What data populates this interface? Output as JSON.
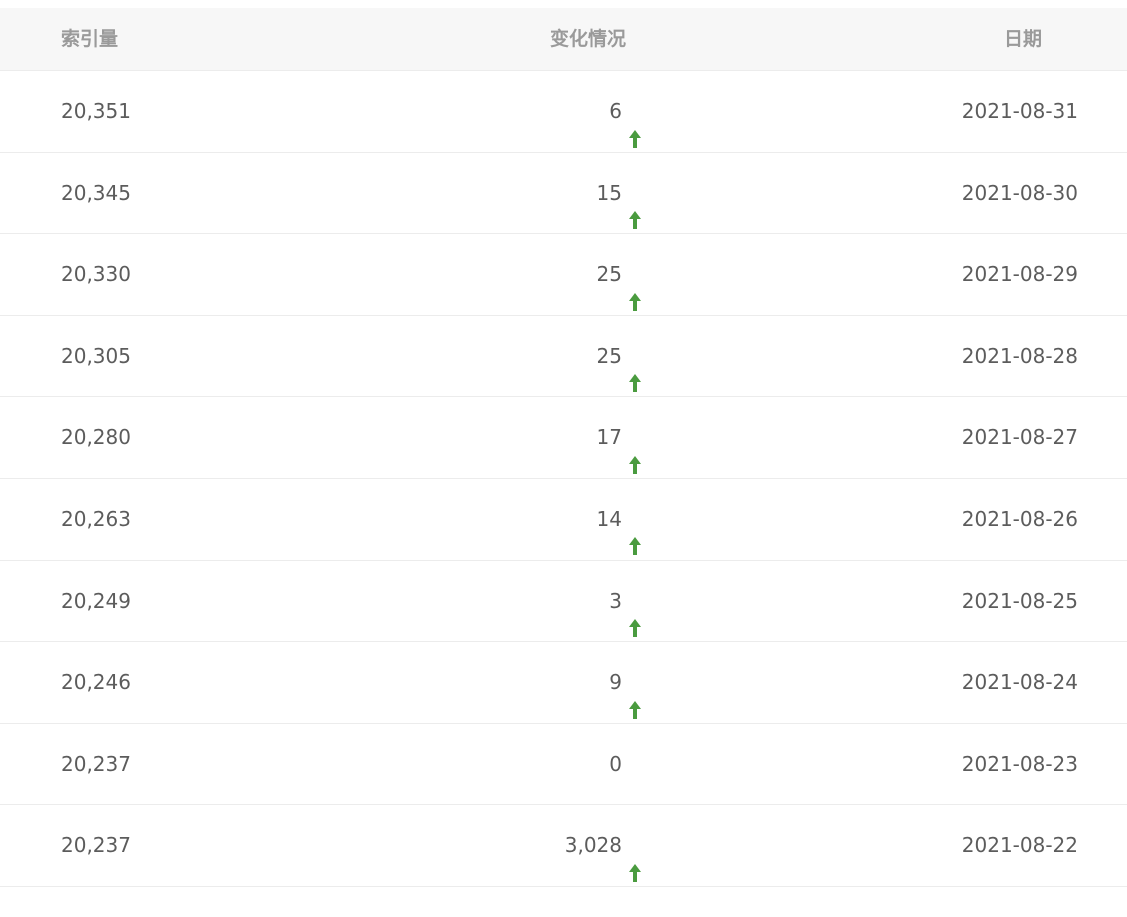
{
  "table": {
    "headers": {
      "index": "索引量",
      "change": "变化情况",
      "date": "日期"
    },
    "colors": {
      "up_arrow": "#4a9b3f",
      "header_bg": "#f7f7f7",
      "header_text": "#9a9a9a",
      "cell_text": "#5c5c5c"
    },
    "rows": [
      {
        "index": "20,351",
        "change": "6",
        "trend": "up",
        "date": "2021-08-31"
      },
      {
        "index": "20,345",
        "change": "15",
        "trend": "up",
        "date": "2021-08-30"
      },
      {
        "index": "20,330",
        "change": "25",
        "trend": "up",
        "date": "2021-08-29"
      },
      {
        "index": "20,305",
        "change": "25",
        "trend": "up",
        "date": "2021-08-28"
      },
      {
        "index": "20,280",
        "change": "17",
        "trend": "up",
        "date": "2021-08-27"
      },
      {
        "index": "20,263",
        "change": "14",
        "trend": "up",
        "date": "2021-08-26"
      },
      {
        "index": "20,249",
        "change": "3",
        "trend": "up",
        "date": "2021-08-25"
      },
      {
        "index": "20,246",
        "change": "9",
        "trend": "up",
        "date": "2021-08-24"
      },
      {
        "index": "20,237",
        "change": "0",
        "trend": "none",
        "date": "2021-08-23"
      },
      {
        "index": "20,237",
        "change": "3,028",
        "trend": "up",
        "date": "2021-08-22"
      }
    ]
  }
}
